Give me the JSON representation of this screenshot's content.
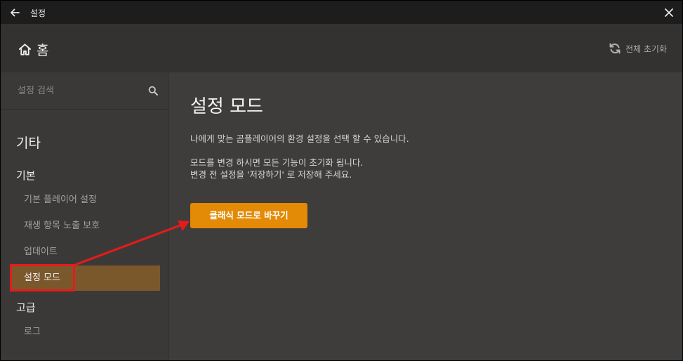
{
  "titlebar": {
    "title": "설정"
  },
  "header": {
    "home_label": "홈",
    "reset_label": "전체 초기화"
  },
  "sidebar": {
    "search_placeholder": "설정 검색",
    "section_etc": "기타",
    "section_basic": "기본",
    "basic_items": [
      "기본 플레이어 설정",
      "재생 항목 노출 보호",
      "업데이트",
      "설정 모드"
    ],
    "section_advanced": "고급",
    "advanced_items": [
      "로그"
    ]
  },
  "main": {
    "title": "설정 모드",
    "desc1": "나에게 맞는 곰플레이어의 환경 설정을 선택 할 수 있습니다.",
    "desc2": "모드를 변경 하시면 모든 기능이 초기화 됩니다.",
    "desc3": "변경 전 설정을 '저장하기' 로 저장해 주세요.",
    "switch_button": "클래식 모드로 바꾸기"
  },
  "colors": {
    "accent": "#e38a06",
    "active_item": "#7b582c",
    "annotation_red": "#e51b1b"
  }
}
